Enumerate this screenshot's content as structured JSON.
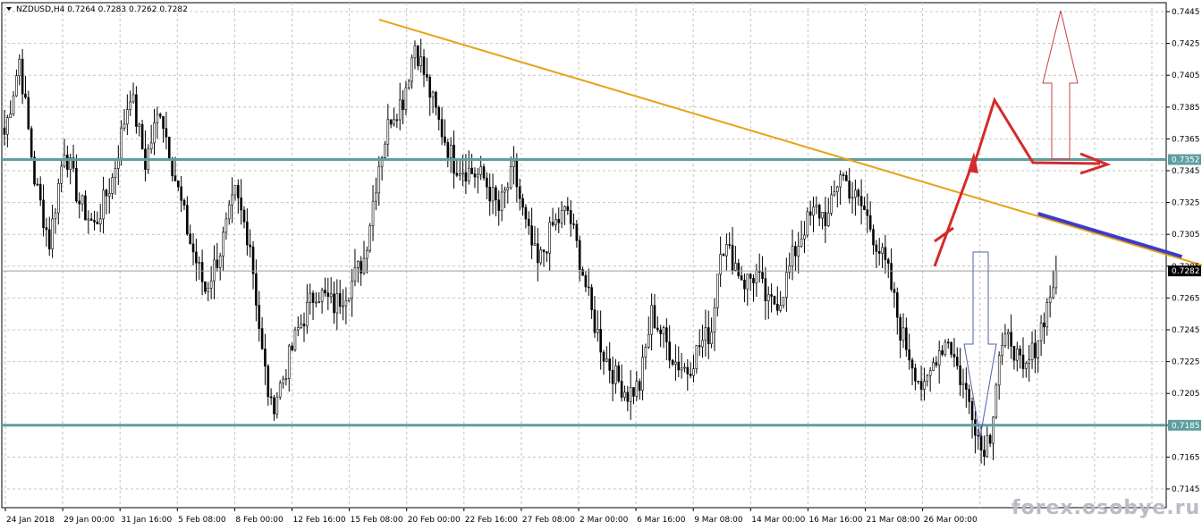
{
  "chart_data": {
    "type": "candlestick",
    "symbol_header": "NZDUSD,H4  0.7264 0.7283 0.7262 0.7282",
    "last_price": 0.7282,
    "last_price_label": "0.7282",
    "ylim": [
      0.7145,
      0.7445
    ],
    "y_ticks": [
      {
        "value": 0.7445,
        "label": "0.7445"
      },
      {
        "value": 0.7425,
        "label": "0.7425"
      },
      {
        "value": 0.7405,
        "label": "0.7405"
      },
      {
        "value": 0.7385,
        "label": "0.7385"
      },
      {
        "value": 0.7365,
        "label": "0.7365"
      },
      {
        "value": 0.7345,
        "label": "0.7345"
      },
      {
        "value": 0.7325,
        "label": "0.7325"
      },
      {
        "value": 0.7305,
        "label": "0.7305"
      },
      {
        "value": 0.7285,
        "label": "0.7285"
      },
      {
        "value": 0.7265,
        "label": "0.7265"
      },
      {
        "value": 0.7245,
        "label": "0.7245"
      },
      {
        "value": 0.7225,
        "label": "0.7225"
      },
      {
        "value": 0.7205,
        "label": "0.7205"
      },
      {
        "value": 0.7185,
        "label": "0.7185"
      },
      {
        "value": 0.7165,
        "label": "0.7165"
      },
      {
        "value": 0.7145,
        "label": "0.7145"
      }
    ],
    "x_labels": [
      "24 Jan 2018",
      "29 Jan 00:00",
      "31 Jan 16:00",
      "5 Feb 08:00",
      "8 Feb 00:00",
      "12 Feb 16:00",
      "15 Feb 08:00",
      "20 Feb 00:00",
      "22 Feb 16:00",
      "27 Feb 08:00",
      "2 Mar 00:00",
      "6 Mar 16:00",
      "9 Mar 08:00",
      "14 Mar 00:00",
      "16 Mar 16:00",
      "21 Mar 08:00",
      "26 Mar 00:00"
    ],
    "grid": true,
    "horizontal_levels": [
      {
        "value": 0.7352,
        "label": "0.7352",
        "color": "#5f9ea0"
      },
      {
        "value": 0.7185,
        "label": "0.7185",
        "color": "#5f9ea0"
      }
    ],
    "trendline": {
      "from": {
        "bar": 125,
        "price": 0.744
      },
      "to": {
        "bar": 440,
        "price": 0.7263
      },
      "color": "#e8a317"
    },
    "highlight_segment": {
      "from": {
        "bar": 345,
        "price": 0.7318
      },
      "to": {
        "bar": 393,
        "price": 0.7291
      },
      "color": "#3c3cc8"
    },
    "price_path": [
      [
        0,
        0.7368
      ],
      [
        5,
        0.7415
      ],
      [
        10,
        0.734
      ],
      [
        15,
        0.73
      ],
      [
        20,
        0.736
      ],
      [
        25,
        0.7325
      ],
      [
        30,
        0.731
      ],
      [
        36,
        0.734
      ],
      [
        42,
        0.7395
      ],
      [
        47,
        0.735
      ],
      [
        52,
        0.7385
      ],
      [
        57,
        0.734
      ],
      [
        62,
        0.73
      ],
      [
        67,
        0.727
      ],
      [
        72,
        0.7295
      ],
      [
        77,
        0.733
      ],
      [
        82,
        0.73
      ],
      [
        86,
        0.723
      ],
      [
        89,
        0.7195
      ],
      [
        93,
        0.7215
      ],
      [
        98,
        0.7245
      ],
      [
        104,
        0.727
      ],
      [
        110,
        0.726
      ],
      [
        116,
        0.7275
      ],
      [
        120,
        0.729
      ],
      [
        125,
        0.735
      ],
      [
        129,
        0.738
      ],
      [
        133,
        0.739
      ],
      [
        137,
        0.7425
      ],
      [
        141,
        0.74
      ],
      [
        145,
        0.7375
      ],
      [
        150,
        0.735
      ],
      [
        155,
        0.7345
      ],
      [
        160,
        0.734
      ],
      [
        165,
        0.732
      ],
      [
        170,
        0.7345
      ],
      [
        174,
        0.731
      ],
      [
        178,
        0.7285
      ],
      [
        183,
        0.731
      ],
      [
        188,
        0.732
      ],
      [
        192,
        0.729
      ],
      [
        196,
        0.7255
      ],
      [
        200,
        0.723
      ],
      [
        204,
        0.7215
      ],
      [
        208,
        0.7205
      ],
      [
        212,
        0.721
      ],
      [
        216,
        0.7255
      ],
      [
        220,
        0.724
      ],
      [
        224,
        0.7225
      ],
      [
        228,
        0.722
      ],
      [
        232,
        0.7235
      ],
      [
        236,
        0.7245
      ],
      [
        239,
        0.73
      ],
      [
        243,
        0.729
      ],
      [
        247,
        0.7275
      ],
      [
        251,
        0.728
      ],
      [
        255,
        0.726
      ],
      [
        259,
        0.7265
      ],
      [
        263,
        0.729
      ],
      [
        267,
        0.731
      ],
      [
        271,
        0.732
      ],
      [
        275,
        0.7315
      ],
      [
        279,
        0.7345
      ],
      [
        283,
        0.733
      ],
      [
        287,
        0.732
      ],
      [
        291,
        0.73
      ],
      [
        295,
        0.728
      ],
      [
        299,
        0.7245
      ],
      [
        303,
        0.7225
      ],
      [
        307,
        0.7205
      ],
      [
        311,
        0.723
      ],
      [
        315,
        0.724
      ],
      [
        319,
        0.7215
      ],
      [
        323,
        0.7195
      ],
      [
        326,
        0.717
      ],
      [
        329,
        0.718
      ],
      [
        332,
        0.723
      ],
      [
        336,
        0.724
      ],
      [
        340,
        0.7215
      ],
      [
        344,
        0.7235
      ],
      [
        348,
        0.726
      ],
      [
        351,
        0.7282
      ]
    ],
    "annotations": [
      {
        "kind": "red-arrow-up",
        "description": "projected breakout path"
      },
      {
        "kind": "hollow-arrow-up",
        "color": "#c84040"
      },
      {
        "kind": "hollow-arrow-down",
        "color": "#5060b0"
      }
    ]
  },
  "watermark": "forex.osobye.ru",
  "colors": {
    "background": "#ffffff",
    "grid": "#c4c4c4",
    "candle": "#000000",
    "level": "#5f9ea0",
    "trendline": "#e8a317",
    "segment": "#3c3cc8",
    "arrow_red": "#d42a2a",
    "arrow_up_outline": "#c84040",
    "arrow_down_outline": "#5060b0"
  }
}
